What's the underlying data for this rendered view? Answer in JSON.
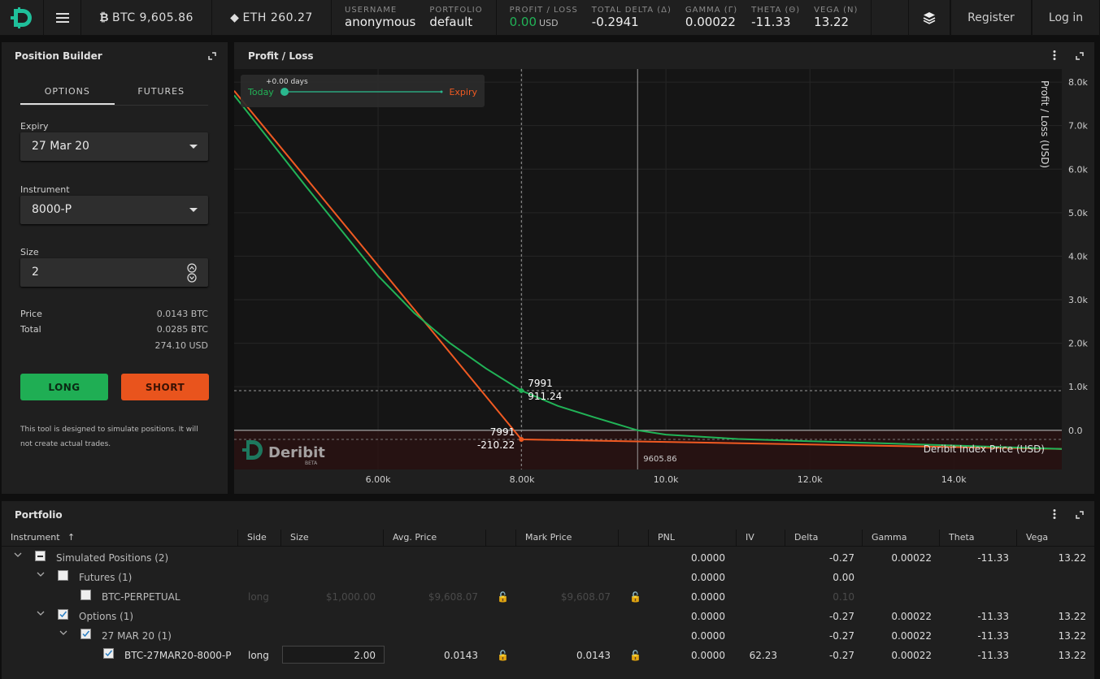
{
  "topbar": {
    "btc_ticker": "BTC 9,605.86",
    "eth_ticker": "ETH 260.27",
    "stats": {
      "username": {
        "label": "USERNAME",
        "value": "anonymous"
      },
      "portfolio": {
        "label": "PORTFOLIO",
        "value": "default"
      },
      "pnl": {
        "label": "PROFIT / LOSS",
        "value": "0.00",
        "unit": "USD"
      },
      "delta": {
        "label": "TOTAL DELTA (Δ)",
        "value": "-0.2941"
      },
      "gamma": {
        "label": "GAMMA (Γ)",
        "value": "0.00022"
      },
      "theta": {
        "label": "THETA (Θ)",
        "value": "-11.33"
      },
      "vega": {
        "label": "VEGA (Ν)",
        "value": "13.22"
      }
    },
    "register": "Register",
    "login": "Log in"
  },
  "builder": {
    "title": "Position Builder",
    "tabs": [
      "OPTIONS",
      "FUTURES"
    ],
    "expiry_label": "Expiry",
    "expiry_value": "27 Mar 20",
    "instrument_label": "Instrument",
    "instrument_value": "8000-P",
    "size_label": "Size",
    "size_value": "2",
    "price_label": "Price",
    "price_value": "0.0143 BTC",
    "total_label": "Total",
    "total_btc": "0.0285 BTC",
    "total_usd": "274.10 USD",
    "long": "LONG",
    "short": "SHORT",
    "note": "This tool is designed to simulate positions. It will not create actual trades."
  },
  "chart_data": {
    "type": "line",
    "title": "Profit / Loss",
    "xlabel": "Deribit Index Price (USD)",
    "ylabel": "Profit / Loss (USD)",
    "xlim": [
      4000,
      15500
    ],
    "ylim": [
      -900,
      8300
    ],
    "x_ticks": [
      "6.00k",
      "8.00k",
      "10.0k",
      "12.0k",
      "14.0k"
    ],
    "x_tick_values": [
      6000,
      8000,
      10000,
      12000,
      14000
    ],
    "y_ticks": [
      "0.0",
      "1.0k",
      "2.0k",
      "3.0k",
      "4.0k",
      "5.0k",
      "6.0k",
      "7.0k",
      "8.0k"
    ],
    "y_tick_values": [
      0,
      1000,
      2000,
      3000,
      4000,
      5000,
      6000,
      7000,
      8000
    ],
    "series": [
      {
        "name": "Today",
        "color": "#21b357",
        "x": [
          4000,
          5000,
          6000,
          6500,
          7000,
          7500,
          7991,
          8500,
          9000,
          9605.86,
          10000,
          11000,
          12000,
          13000,
          14000,
          15500
        ],
        "y": [
          7700,
          5600,
          3550,
          2700,
          2000,
          1420,
          911.24,
          560,
          300,
          0,
          -100,
          -200,
          -250,
          -300,
          -350,
          -430
        ]
      },
      {
        "name": "Expiry",
        "color": "#f05a22",
        "x": [
          4000,
          7991,
          15500
        ],
        "y": [
          7800,
          -210.22,
          -430
        ]
      }
    ],
    "crosshair": {
      "x": 7991,
      "today_y": 911.24,
      "expiry_y": -210.22
    },
    "crosshair_labels": {
      "today_x": "7991",
      "today_y": "911.24",
      "expiry_x": "7991",
      "expiry_y": "-210.22"
    },
    "index_price": 9605.86,
    "index_price_label": "9605.86",
    "slider": {
      "days": "+0.00 days",
      "left": "Today",
      "right": "Expiry"
    },
    "watermark": "Deribit",
    "watermark_sub": "BETA"
  },
  "portfolio": {
    "title": "Portfolio",
    "columns": [
      "Instrument",
      "Side",
      "Size",
      "Avg. Price",
      "",
      "Mark Price",
      "",
      "PNL",
      "IV",
      "Delta",
      "Gamma",
      "Theta",
      "Vega"
    ],
    "rows": [
      {
        "name": "Simulated Positions (2)",
        "pnl": "0.0000",
        "delta": "-0.27",
        "gamma": "0.00022",
        "theta": "-11.33",
        "vega": "13.22"
      },
      {
        "name": "Futures (1)",
        "pnl": "0.0000",
        "delta": "0.00"
      },
      {
        "name": "BTC-PERPETUAL",
        "side": "long",
        "size": "$1,000.00",
        "avg": "$9,608.07",
        "mark": "$9,608.07",
        "pnl": "0.0000",
        "delta": "0.10"
      },
      {
        "name": "Options (1)",
        "pnl": "0.0000",
        "delta": "-0.27",
        "gamma": "0.00022",
        "theta": "-11.33",
        "vega": "13.22"
      },
      {
        "name": "27 MAR 20 (1)",
        "pnl": "0.0000",
        "delta": "-0.27",
        "gamma": "0.00022",
        "theta": "-11.33",
        "vega": "13.22"
      },
      {
        "name": "BTC-27MAR20-8000-P",
        "side": "long",
        "size": "2.00",
        "avg": "0.0143",
        "mark": "0.0143",
        "pnl": "0.0000",
        "iv": "62.23",
        "delta": "-0.27",
        "gamma": "0.00022",
        "theta": "-11.33",
        "vega": "13.22"
      }
    ]
  }
}
